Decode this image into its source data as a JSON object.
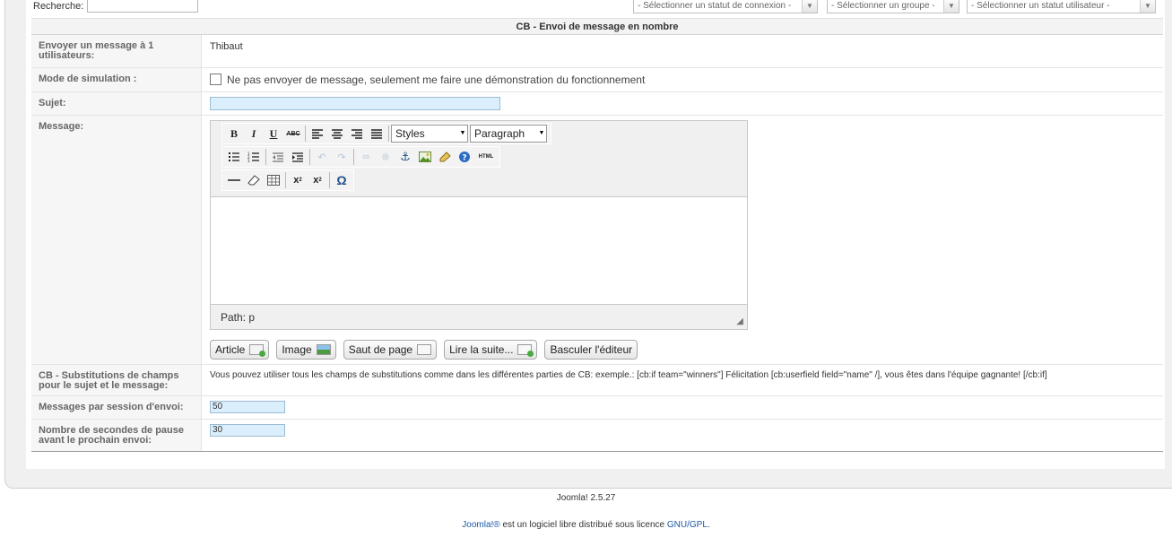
{
  "filter": {
    "search_label": "Recherche:",
    "search_value": "",
    "select_connection": "- Sélectionner un statut de connexion -",
    "select_group": "- Sélectionner un groupe -",
    "select_user_status": "- Sélectionner un statut utilisateur -"
  },
  "table_title": "CB - Envoi de message en nombre",
  "rows": {
    "recipients": {
      "label": "Envoyer un message à 1 utilisateurs:",
      "value": "Thibaut"
    },
    "simulation": {
      "label": "Mode de simulation :",
      "checkbox_label": "Ne pas envoyer de message, seulement me faire une démonstration du fonctionnement",
      "checked": false
    },
    "subject": {
      "label": "Sujet:",
      "value": ""
    },
    "message": {
      "label": "Message:"
    },
    "substitutions": {
      "label": "CB - Substitutions de champs pour le sujet et le message:",
      "value": "Vous pouvez utiliser tous les champs de substitutions comme dans les différentes parties de CB: exemple.: [cb:if team=\"winners\"] Félicitation [cb:userfield field=\"name\" /], vous êtes dans l'équipe gagnante! [/cb:if]"
    },
    "per_session": {
      "label": "Messages par session d'envoi:",
      "value": "50"
    },
    "pause": {
      "label": "Nombre de secondes de pause avant le prochain envoi:",
      "value": "30"
    }
  },
  "editor": {
    "styles_select": "Styles",
    "format_select": "Paragraph",
    "path_text": "Path: p",
    "html_label": "HTML",
    "toolbar_icons": {
      "row1": [
        "bold-icon",
        "italic-icon",
        "underline-icon",
        "strikethrough-icon",
        "align-left-icon",
        "align-center-icon",
        "align-right-icon",
        "align-justify-icon"
      ],
      "row2": [
        "bullet-list-icon",
        "numbered-list-icon",
        "outdent-icon",
        "indent-icon",
        "undo-icon",
        "redo-icon",
        "link-icon",
        "unlink-icon",
        "anchor-icon",
        "image-icon",
        "cleanup-icon",
        "help-icon",
        "html-icon"
      ],
      "row3": [
        "horizontal-rule-icon",
        "remove-format-icon",
        "table-icon",
        "subscript-icon",
        "superscript-icon",
        "special-char-icon"
      ]
    }
  },
  "editor_buttons": {
    "article": "Article",
    "image": "Image",
    "pagebreak": "Saut de page",
    "readmore": "Lire la suite...",
    "toggle_editor": "Basculer l'éditeur"
  },
  "footer": {
    "version": "Joomla! 2.5.27",
    "license_link_joomla": "Joomla!®",
    "license_text": " est un logiciel libre distribué sous licence ",
    "license_link_gpl": "GNU/GPL",
    "license_end": "."
  },
  "colors": {
    "input_blue": "#dbeefb",
    "link": "#1b57a8",
    "panel_bg": "#f0f0f0"
  }
}
